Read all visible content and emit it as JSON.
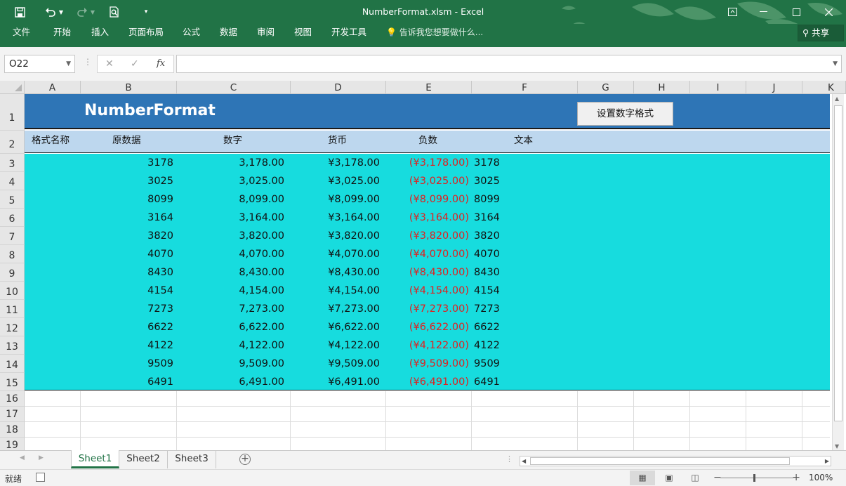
{
  "window": {
    "title": "NumberFormat.xlsm - Excel"
  },
  "quick_access": [
    "save-icon",
    "undo-icon",
    "redo-icon",
    "print-preview-icon",
    "customize-icon"
  ],
  "ribbon": {
    "tabs": [
      "文件",
      "开始",
      "插入",
      "页面布局",
      "公式",
      "数据",
      "审阅",
      "视图",
      "开发工具"
    ],
    "tell_me": "告诉我您想要做什么...",
    "share": "共享"
  },
  "formula_bar": {
    "name_box": "O22",
    "fx": "fx",
    "content": ""
  },
  "columns": [
    "A",
    "B",
    "C",
    "D",
    "E",
    "F",
    "G",
    "H",
    "I",
    "J",
    "K"
  ],
  "rows": [
    "1",
    "2",
    "3",
    "4",
    "5",
    "6",
    "7",
    "8",
    "9",
    "10",
    "11",
    "12",
    "13",
    "14",
    "15",
    "16",
    "17",
    "18",
    "19"
  ],
  "sheet": {
    "title": "NumberFormat",
    "button_label": "设置数字格式",
    "headers": [
      "格式名称",
      "原数据",
      "数字",
      "货币",
      "负数",
      "文本"
    ],
    "data": [
      [
        "3178",
        "3,178.00",
        "¥3,178.00",
        "(¥3,178.00)",
        "3178"
      ],
      [
        "3025",
        "3,025.00",
        "¥3,025.00",
        "(¥3,025.00)",
        "3025"
      ],
      [
        "8099",
        "8,099.00",
        "¥8,099.00",
        "(¥8,099.00)",
        "8099"
      ],
      [
        "3164",
        "3,164.00",
        "¥3,164.00",
        "(¥3,164.00)",
        "3164"
      ],
      [
        "3820",
        "3,820.00",
        "¥3,820.00",
        "(¥3,820.00)",
        "3820"
      ],
      [
        "4070",
        "4,070.00",
        "¥4,070.00",
        "(¥4,070.00)",
        "4070"
      ],
      [
        "8430",
        "8,430.00",
        "¥8,430.00",
        "(¥8,430.00)",
        "8430"
      ],
      [
        "4154",
        "4,154.00",
        "¥4,154.00",
        "(¥4,154.00)",
        "4154"
      ],
      [
        "7273",
        "7,273.00",
        "¥7,273.00",
        "(¥7,273.00)",
        "7273"
      ],
      [
        "6622",
        "6,622.00",
        "¥6,622.00",
        "(¥6,622.00)",
        "6622"
      ],
      [
        "4122",
        "4,122.00",
        "¥4,122.00",
        "(¥4,122.00)",
        "4122"
      ],
      [
        "9509",
        "9,509.00",
        "¥9,509.00",
        "(¥9,509.00)",
        "9509"
      ],
      [
        "6491",
        "6,491.00",
        "¥6,491.00",
        "(¥6,491.00)",
        "6491"
      ]
    ]
  },
  "sheet_tabs": [
    "Sheet1",
    "Sheet2",
    "Sheet3"
  ],
  "active_sheet": "Sheet1",
  "status": {
    "ready": "就绪",
    "zoom": "100%"
  },
  "colors": {
    "excel_green": "#217346",
    "title_band": "#2e75b6",
    "header_band": "#bdd7ee",
    "data_band": "#17dcde",
    "negative": "#e02020"
  }
}
